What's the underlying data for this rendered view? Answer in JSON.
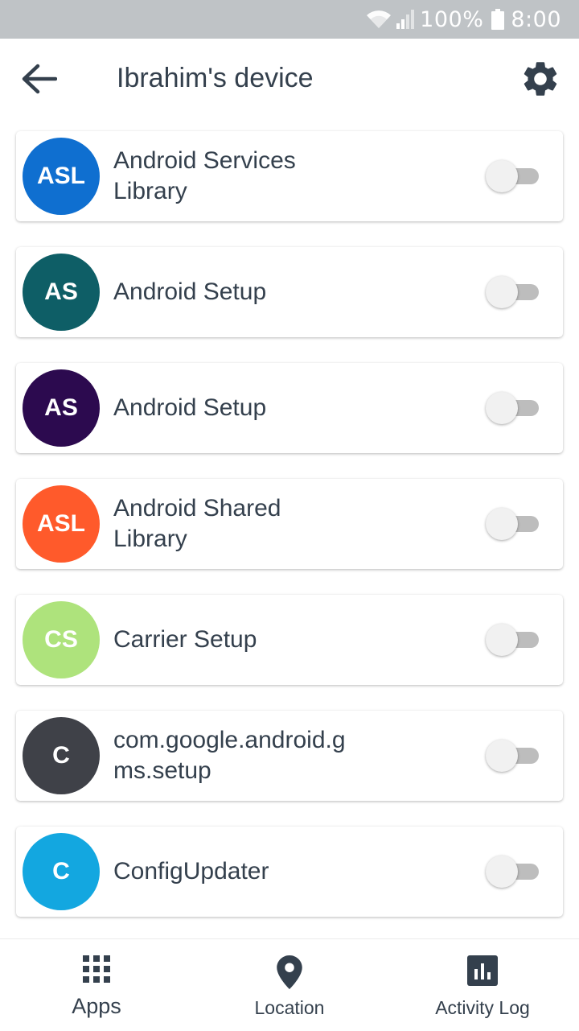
{
  "status_bar": {
    "battery": "100%",
    "time": "8:00",
    "icons": [
      "wifi-icon",
      "signal-icon",
      "battery-icon"
    ]
  },
  "header": {
    "title": "Ibrahim's device",
    "back_icon": "arrow-left-icon",
    "settings_icon": "gear-icon"
  },
  "apps": [
    {
      "initials": "ASL",
      "name": "Android Services Library",
      "color": "#0f6fd0",
      "enabled": false
    },
    {
      "initials": "AS",
      "name": "Android Setup",
      "color": "#0e5e66",
      "enabled": false
    },
    {
      "initials": "AS",
      "name": "Android Setup",
      "color": "#2c0a4f",
      "enabled": false
    },
    {
      "initials": "ASL",
      "name": "Android Shared Library",
      "color": "#ff5a2b",
      "enabled": false
    },
    {
      "initials": "CS",
      "name": "Carrier Setup",
      "color": "#aee37c",
      "enabled": false
    },
    {
      "initials": "C",
      "name": "com.google.android.gms.setup",
      "color": "#3f4148",
      "enabled": false
    },
    {
      "initials": "C",
      "name": "ConfigUpdater",
      "color": "#13a7e0",
      "enabled": false
    }
  ],
  "bottom_nav": {
    "items": [
      {
        "label": "Apps",
        "icon": "grid-icon"
      },
      {
        "label": "Location",
        "icon": "location-pin-icon"
      },
      {
        "label": "Activity Log",
        "icon": "bar-chart-icon"
      }
    ]
  },
  "colors": {
    "text": "#34404d",
    "status_bar": "#bfc3c6",
    "toggle_track": "#bdbdbd",
    "toggle_thumb": "#f1f1f1"
  }
}
